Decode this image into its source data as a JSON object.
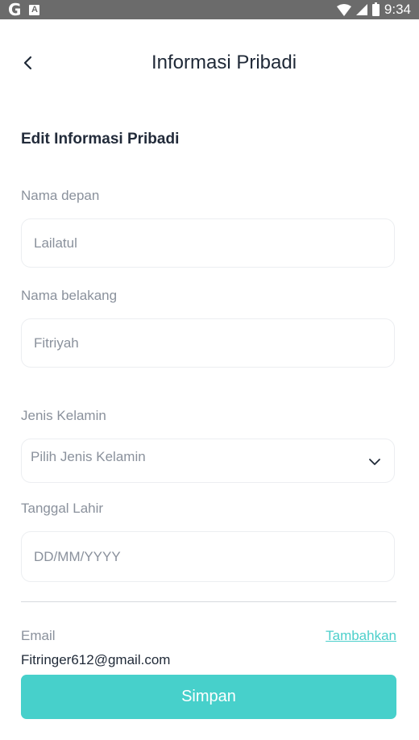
{
  "status_bar": {
    "time": "9:34",
    "icons": [
      "google-icon",
      "a-icon",
      "wifi-icon",
      "signal-icon",
      "battery-icon"
    ]
  },
  "header": {
    "title": "Informasi Pribadi",
    "back_icon": "chevron-left-icon"
  },
  "form": {
    "section_title": "Edit Informasi Pribadi",
    "first_name": {
      "label": "Nama depan",
      "value": "Lailatul"
    },
    "last_name": {
      "label": "Nama belakang",
      "value": "Fitriyah"
    },
    "gender": {
      "label": "Jenis Kelamin",
      "placeholder": "Pilih Jenis Kelamin"
    },
    "birthdate": {
      "label": "Tanggal Lahir",
      "placeholder": "DD/MM/YYYY"
    }
  },
  "email": {
    "label": "Email",
    "add_link": "Tambahkan",
    "value": "Fitringer612@gmail.com"
  },
  "actions": {
    "save_label": "Simpan"
  },
  "colors": {
    "accent": "#47d0cb",
    "link": "#4ccfcb",
    "status_bar": "#6b6b6b"
  }
}
